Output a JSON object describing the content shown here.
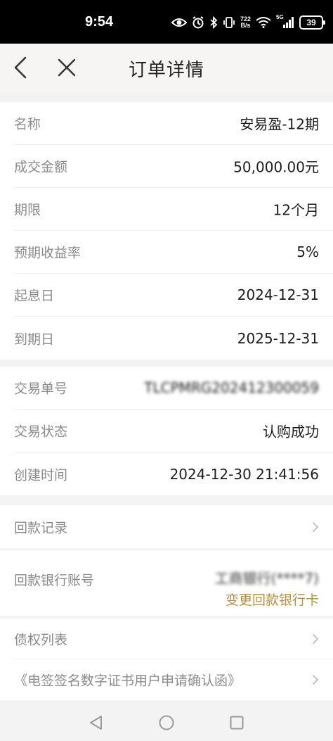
{
  "status_bar": {
    "time": "9:54",
    "net_speed_value": "722",
    "net_speed_unit": "B/s",
    "network": "5G",
    "battery": "39",
    "icons": [
      "eye-icon",
      "alarm-icon",
      "bluetooth-icon",
      "vibrate-icon",
      "wifi-icon",
      "signal-icon",
      "battery-icon"
    ]
  },
  "nav": {
    "title": "订单详情",
    "back_icon": "chevron-left-icon",
    "close_icon": "close-icon"
  },
  "product_info": [
    {
      "label": "名称",
      "value": "安易盈-12期"
    },
    {
      "label": "成交金额",
      "value": "50,000.00元"
    },
    {
      "label": "期限",
      "value": "12个月"
    },
    {
      "label": "预期收益率",
      "value": "5%"
    },
    {
      "label": "起息日",
      "value": "2024-12-31"
    },
    {
      "label": "到期日",
      "value": "2025-12-31"
    }
  ],
  "trade_info": [
    {
      "label": "交易单号",
      "value": "TLCPMRG202412300059"
    },
    {
      "label": "交易状态",
      "value": "认购成功"
    },
    {
      "label": "创建时间",
      "value": "2024-12-30 21:41:56"
    }
  ],
  "repay_record": {
    "label": "回款记录"
  },
  "repay_bank": {
    "label": "回款银行账号",
    "bank": "工商银行(****7)",
    "change_link": "变更回款银行卡"
  },
  "links": [
    {
      "label": "债权列表"
    },
    {
      "label": "《电签签名数字证书用户申请确认函》"
    }
  ],
  "colors": {
    "accent_link": "#b8913f",
    "label_gray": "#8b8b8b",
    "background": "#f4f3f3"
  }
}
